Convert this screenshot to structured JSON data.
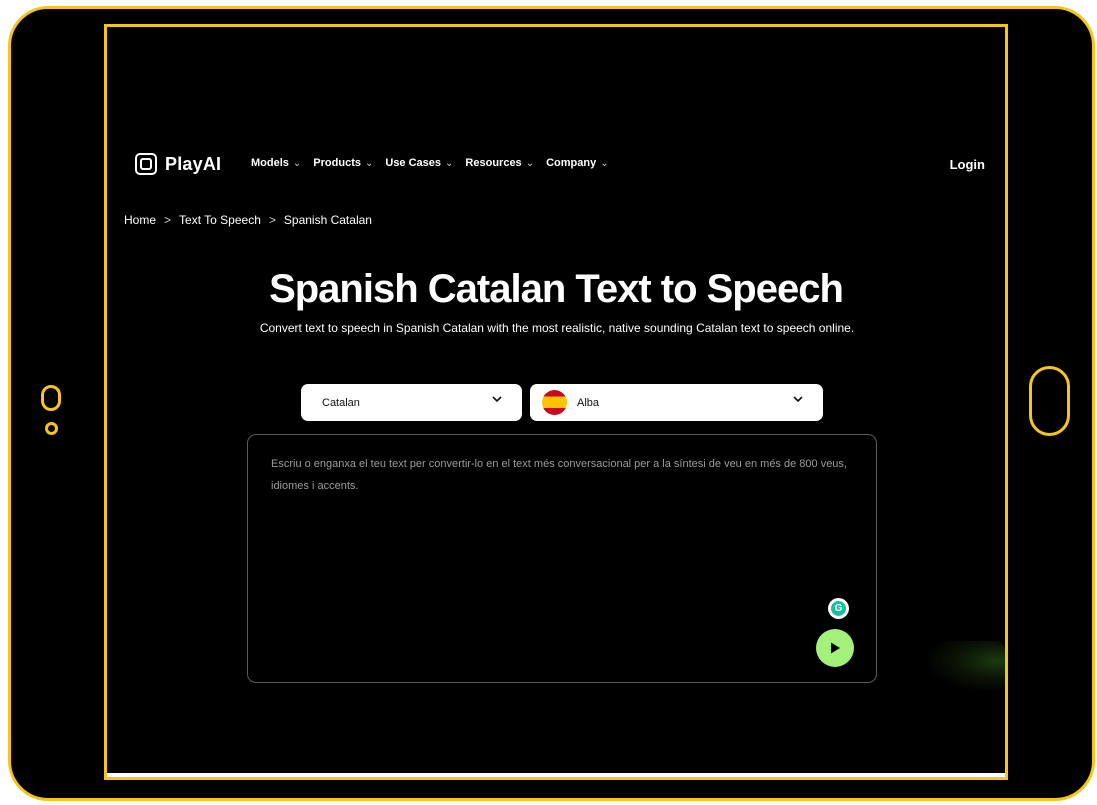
{
  "brand": {
    "name": "PlayAI"
  },
  "nav": {
    "items": [
      {
        "label": "Models"
      },
      {
        "label": "Products"
      },
      {
        "label": "Use Cases"
      },
      {
        "label": "Resources"
      },
      {
        "label": "Company"
      }
    ],
    "login_label": "Login"
  },
  "breadcrumb": {
    "items": [
      "Home",
      "Text To Speech",
      "Spanish Catalan"
    ],
    "separator": ">"
  },
  "hero": {
    "title": "Spanish Catalan Text to Speech",
    "subtitle": "Convert text to speech in Spanish Catalan with the most realistic, native sounding Catalan text to speech online."
  },
  "language_select": {
    "value": "Catalan"
  },
  "voice_select": {
    "value": "Alba",
    "flag_icon": "spain-flag-icon"
  },
  "editor": {
    "placeholder": "Escriu o enganxa el teu text per convertir-lo en el text més conversacional per a la síntesi de veu en més de 800 veus, idiomes i accents."
  },
  "colors": {
    "frame": "#f5c518",
    "background": "#000000",
    "play_button": "#a3f07a"
  }
}
